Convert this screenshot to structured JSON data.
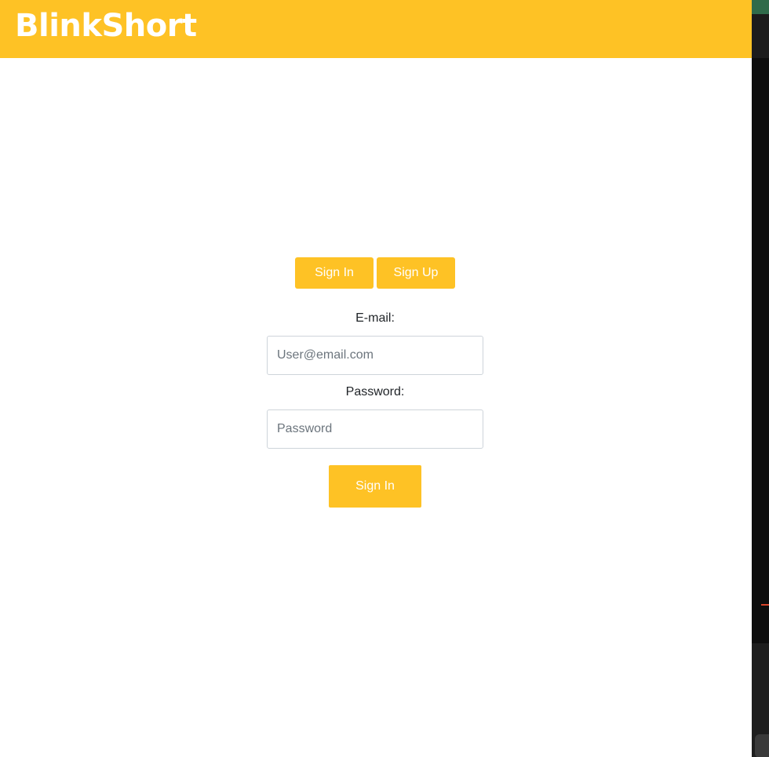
{
  "header": {
    "brand": "BlinkShort"
  },
  "auth_tabs": {
    "sign_in_label": "Sign In",
    "sign_up_label": "Sign Up"
  },
  "form": {
    "email_label": "E-mail:",
    "email_placeholder": "User@email.com",
    "email_value": "",
    "password_label": "Password:",
    "password_placeholder": "Password",
    "password_value": "",
    "submit_label": "Sign In"
  },
  "colors": {
    "accent": "#fec225",
    "text": "#212529",
    "background": "#ffffff"
  }
}
